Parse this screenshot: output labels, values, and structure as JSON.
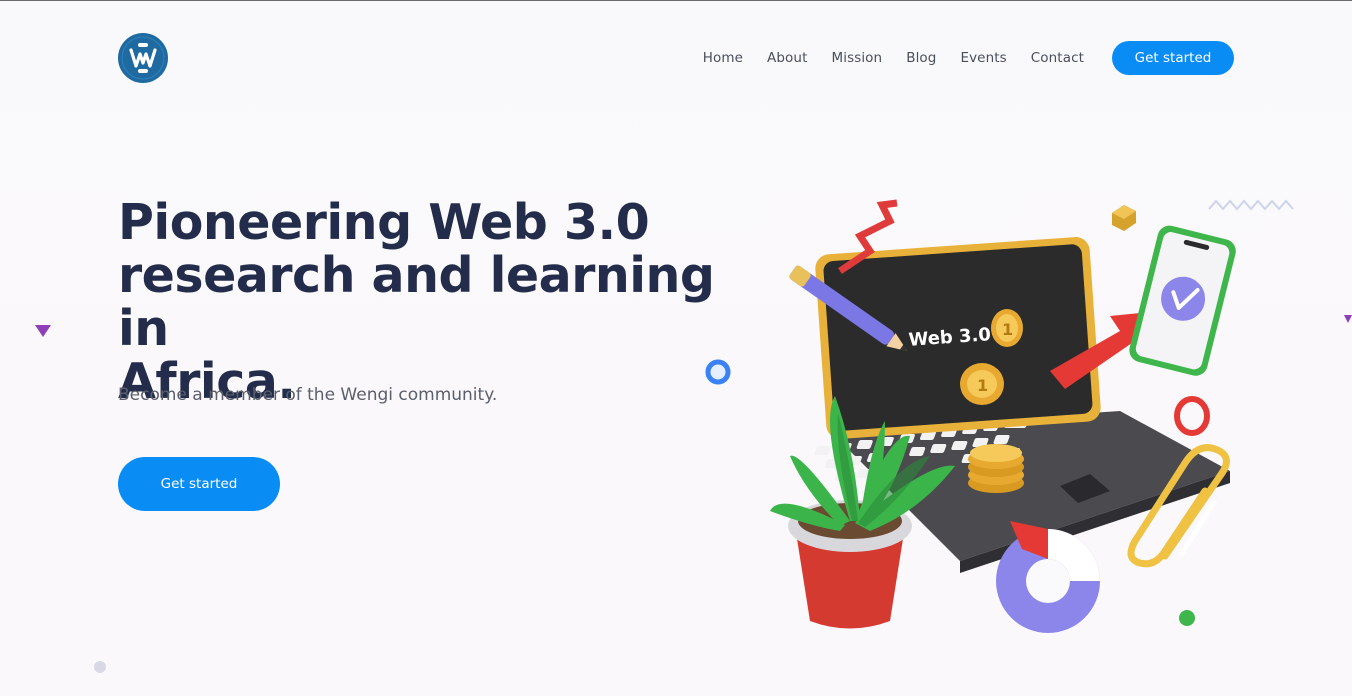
{
  "header": {
    "logo_letter": "w",
    "nav": [
      {
        "label": "Home"
      },
      {
        "label": "About"
      },
      {
        "label": "Mission"
      },
      {
        "label": "Blog"
      },
      {
        "label": "Events"
      },
      {
        "label": "Contact"
      }
    ],
    "cta_label": "Get started"
  },
  "hero": {
    "title_line1": "Pioneering Web 3.0",
    "title_line2": "research and learning in",
    "title_line3": "Africa.",
    "subtitle": "Become a member of the Wengi community.",
    "cta_label": "Get started"
  },
  "illustration": {
    "screen_text": "Web 3.0",
    "coin_label": "1"
  },
  "colors": {
    "accent": "#0a8cf5",
    "heading": "#232d4b",
    "body_text": "#5a5f6b",
    "logo_bg": "#1f6aa0"
  }
}
